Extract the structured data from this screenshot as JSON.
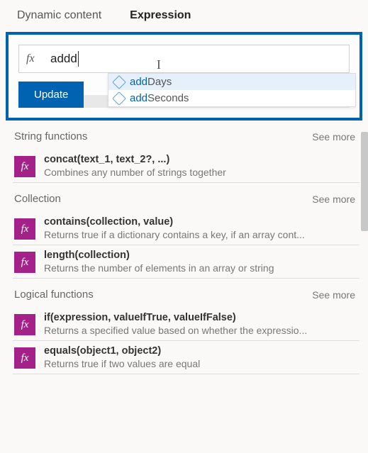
{
  "tabs": {
    "dynamic": "Dynamic content",
    "expression": "Expression"
  },
  "expression_input": {
    "value": "addd",
    "fx": "fx"
  },
  "autocomplete": {
    "items": [
      {
        "match": "add",
        "rest": "Days"
      },
      {
        "match": "add",
        "rest": "Seconds"
      }
    ]
  },
  "update_button": "Update",
  "categories": [
    {
      "name": "String functions",
      "see_more": "See more",
      "functions": [
        {
          "signature": "concat(text_1, text_2?, ...)",
          "description": "Combines any number of strings together"
        }
      ]
    },
    {
      "name": "Collection",
      "see_more": "See more",
      "functions": [
        {
          "signature": "contains(collection, value)",
          "description": "Returns true if a dictionary contains a key, if an array cont..."
        },
        {
          "signature": "length(collection)",
          "description": "Returns the number of elements in an array or string"
        }
      ]
    },
    {
      "name": "Logical functions",
      "see_more": "See more",
      "functions": [
        {
          "signature": "if(expression, valueIfTrue, valueIfFalse)",
          "description": "Returns a specified value based on whether the expressio..."
        },
        {
          "signature": "equals(object1, object2)",
          "description": "Returns true if two values are equal"
        }
      ]
    }
  ],
  "fn_icon_label": "fx"
}
